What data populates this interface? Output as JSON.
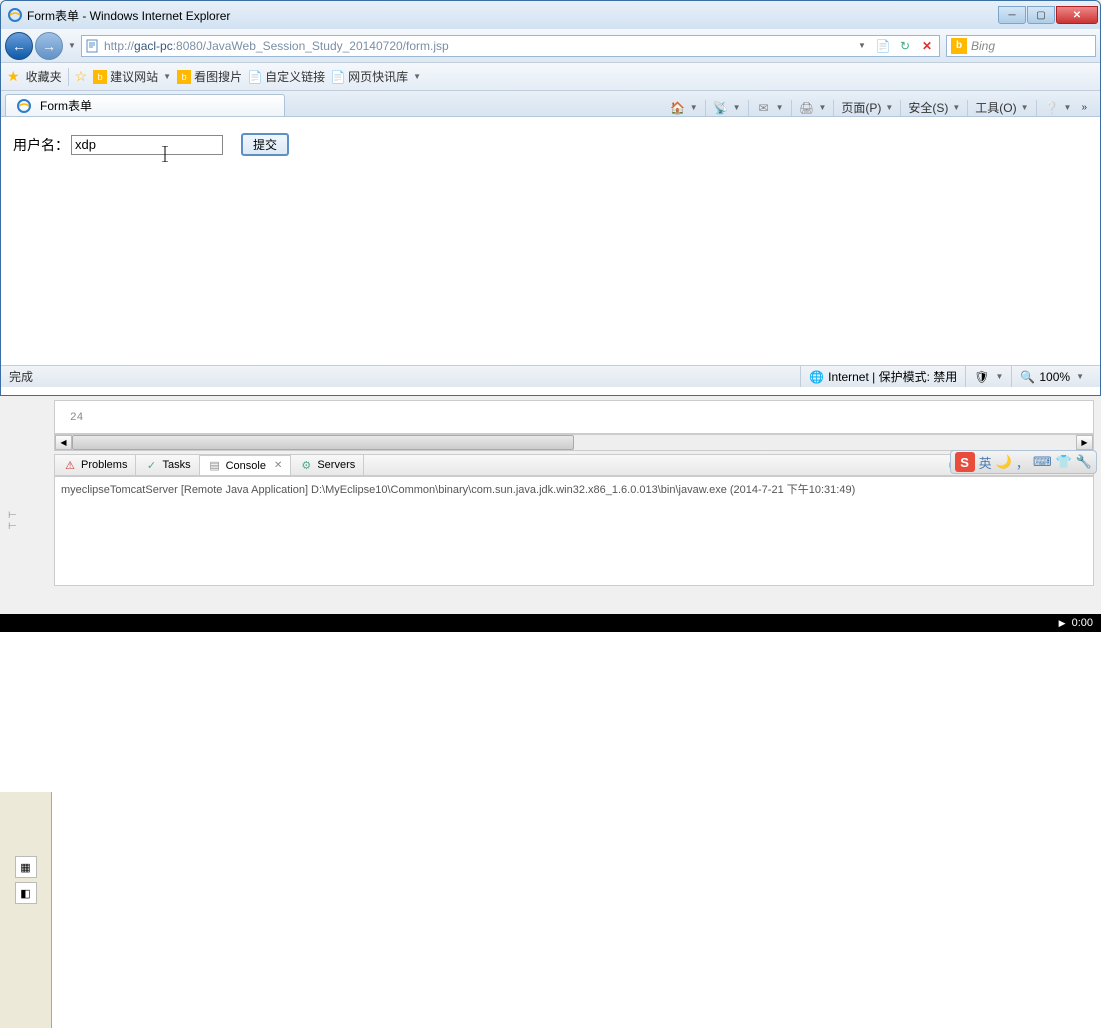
{
  "window": {
    "title": "Form表单 - Windows Internet Explorer"
  },
  "nav": {
    "url_prefix": "http://",
    "url_host": "gacl-pc",
    "url_port": ":8080",
    "url_path": "/JavaWeb_Session_Study_20140720/form.jsp",
    "search_engine": "Bing"
  },
  "favorites": {
    "label": "收藏夹",
    "items": [
      "建议网站",
      "看图搜片",
      "自定义链接",
      "网页快讯库"
    ]
  },
  "tab": {
    "title": "Form表单"
  },
  "toolbar": {
    "page": "页面(P)",
    "safety": "安全(S)",
    "tools": "工具(O)"
  },
  "form": {
    "label": "用户名：",
    "value": "xdp",
    "submit": "提交"
  },
  "status": {
    "done": "完成",
    "zone": "Internet | 保护模式: 禁用",
    "zoom": "100%"
  },
  "editor": {
    "line_number": "24"
  },
  "console": {
    "tabs": {
      "problems": "Problems",
      "tasks": "Tasks",
      "console": "Console",
      "servers": "Servers"
    },
    "output": "myeclipseTomcatServer [Remote Java Application] D:\\MyEclipse10\\Common\\binary\\com.sun.java.jdk.win32.x86_1.6.0.013\\bin\\javaw.exe (2014-7-21 下午10:31:49)"
  },
  "ime": {
    "lang": "英"
  },
  "taskbar": {
    "time": "0:00"
  }
}
